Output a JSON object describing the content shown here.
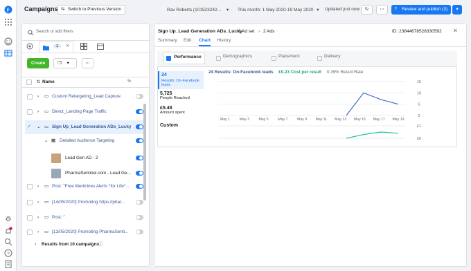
{
  "top": {
    "title": "Campaigns",
    "switch_label": "Switch to Previous Version",
    "account": "Rav Roberts (101523242...",
    "date_range": "This month: 1 May 2020-19 May 2020",
    "updated": "Updated just now",
    "review_label": "Review and publish (3)"
  },
  "left": {
    "search_placeholder": "Search or add filters",
    "tab_count": "1",
    "create_label": "Create",
    "col_name": "Name",
    "col_pct": "%",
    "rows": [
      {
        "label": "Custom Retargeting_Lead Capture",
        "checked": false,
        "on": false
      },
      {
        "label": "Direct_Landing Page Traffic",
        "checked": false,
        "on": true
      },
      {
        "label": "Sign Up_Lead Generation ADs_Lucky",
        "checked": true,
        "on": true
      },
      {
        "label": "Detailed Audience Targeting",
        "checked": false,
        "on": true
      },
      {
        "label": "Lead Gen AD - 2",
        "checked": false,
        "on": true
      },
      {
        "label": "PharmaSentinel.com - Lead Ge...",
        "checked": false,
        "on": true
      },
      {
        "label": "Post: \"Free Medicines Alerts *for Life*...",
        "checked": false,
        "on": true
      },
      {
        "label": "[14/05/2020] Promoting https://phar...",
        "checked": false,
        "on": false
      },
      {
        "label": "Post: \"",
        "checked": false,
        "on": false
      },
      {
        "label": "[12/05/2020] Promoting PharmaSenti...",
        "checked": false,
        "on": false
      }
    ],
    "results_label": "Results from 10 campaigns"
  },
  "detail": {
    "breadcrumb_main": "Sign Up_Lead Generation ADs_Lucky",
    "breadcrumb_adset": "1 Ad set",
    "breadcrumb_ads": "2 Ads",
    "id_text": "ID: 23844678528330592",
    "tabs": [
      "Summary",
      "Edit",
      "Chart",
      "History"
    ],
    "subtabs": [
      "Performance",
      "Demographics",
      "Placement",
      "Delivery"
    ],
    "stats": [
      {
        "value": "24",
        "label": "Results: On-Facebook leads"
      },
      {
        "value": "5,725",
        "label": "People Reached"
      },
      {
        "value": "£5.48",
        "label": "Amount spent"
      },
      {
        "value": "Custom",
        "label": ""
      }
    ],
    "summary_results": "24 Results: On-Facebook leads",
    "summary_cost": "£0.23 Cost per result",
    "summary_rate": "0.39% Result Rate"
  },
  "chart_data": {
    "type": "line",
    "x": [
      "May 1",
      "May 3",
      "May 5",
      "May 7",
      "May 9",
      "May 11",
      "May 13",
      "May 15",
      "May 17",
      "May 19"
    ],
    "series": [
      {
        "values": [
          0,
          0,
          0,
          0,
          0,
          0,
          0,
          0,
          10,
          7,
          5
        ]
      },
      {
        "values": [
          0,
          0,
          0,
          0,
          0,
          0,
          0,
          0,
          0.3,
          0.5,
          0.4
        ]
      }
    ],
    "ylim": [
      0,
      15
    ],
    "yticks": [
      "15",
      "10",
      "5",
      "0"
    ],
    "ylim2_ticks": [
      "£1",
      "£0"
    ],
    "colors": {
      "series1": "#3b6fc0",
      "series2": "#20c0a0"
    }
  }
}
